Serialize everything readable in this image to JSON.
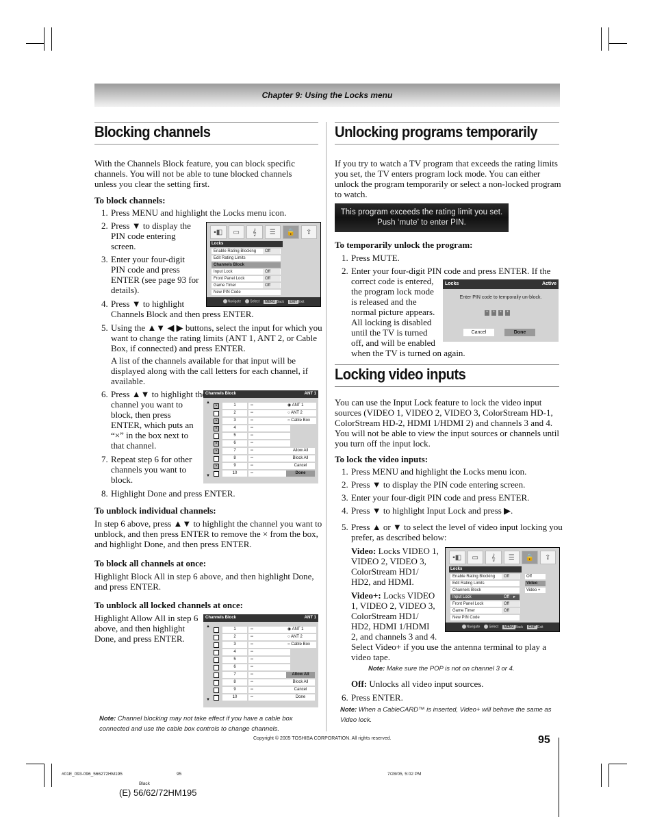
{
  "chapter": "Chapter 9: Using the Locks menu",
  "left": {
    "title": "Blocking channels",
    "intro": "With the Channels Block feature, you can block specific channels. You will not be able to tune blocked channels unless you clear the setting first.",
    "to_block_heading": "To block channels:",
    "steps": [
      {
        "n": "1.",
        "text": "Press MENU and highlight the Locks menu icon."
      },
      {
        "n": "2.",
        "lines": [
          "Press ▼ to display the",
          "PIN code entering",
          "screen."
        ]
      },
      {
        "n": "3.",
        "lines": [
          "Enter your four-digit",
          "PIN code and press",
          "ENTER (see page 93 for",
          "details)."
        ]
      },
      {
        "n": "4.",
        "lines": [
          "Press ▼ to highlight",
          "Channels Block and then press ENTER."
        ]
      },
      {
        "n": "5.",
        "lines": [
          "Using the ▲▼ ◀ ▶ buttons, select the input for which you",
          "want to change the rating limits (ANT 1, ANT 2, or Cable",
          "Box, if connected) and press ENTER."
        ]
      },
      {
        "n": "",
        "lines": [
          "A list of the channels available for that input will be",
          "displayed along with the call letters for each channel, if",
          "available."
        ]
      },
      {
        "n": "6.",
        "lines": [
          "Press ▲▼ to highlight the",
          "channel you want to",
          "block, then press",
          "ENTER, which puts an",
          "“×” in the box next to",
          "that channel."
        ]
      },
      {
        "n": "7.",
        "lines": [
          "Repeat step 6 for other",
          "channels you want to",
          "block."
        ]
      },
      {
        "n": "8.",
        "text": "Highlight Done and press ENTER."
      }
    ],
    "unblock_heading": "To unblock individual channels:",
    "unblock_lines": [
      "In step 6 above, press ▲▼ to highlight the channel you want to",
      "unblock, and then press ENTER to remove the × from the box,",
      "and highlight Done, and then press ENTER."
    ],
    "block_all_heading": "To block all channels at once:",
    "block_all_lines": [
      "Highlight Block All in step 6 above, and then highlight Done,",
      "and press ENTER."
    ],
    "unblock_all_heading": "To unblock all locked channels at once:",
    "unblock_all_lines": [
      "Highlight Allow All in step 6",
      "above, and then highlight",
      "Done, and press ENTER."
    ],
    "note_label": "Note:",
    "note_lines": [
      " Channel blocking may not take effect if you have a cable box",
      "connected and use the cable box controls to change channels."
    ]
  },
  "locks_menu": {
    "title": "Locks",
    "icons": [
      "picture-icon",
      "audio-icon",
      "music-icon",
      "setup-icon",
      "lock-icon",
      "applications-icon"
    ],
    "items": [
      {
        "label": "Enable Rating Blocking",
        "value": "Off"
      },
      {
        "label": "Edit Rating Limits",
        "value": ""
      },
      {
        "label": "Channels Block",
        "value": ""
      },
      {
        "label": "Input Lock",
        "value": "Off"
      },
      {
        "label": "Front Panel Lock",
        "value": "Off"
      },
      {
        "label": "Game Timer",
        "value": "Off"
      },
      {
        "label": "New PIN Code",
        "value": ""
      }
    ],
    "footer": {
      "navigate": "Navigate",
      "select": "Select",
      "back_key": "MENU",
      "back": "Back",
      "exit_key": "EXIT",
      "exit": "Exit"
    }
  },
  "channels_block_1": {
    "title": "Channels Block",
    "input": "ANT 1",
    "channels": [
      {
        "num": "1",
        "call": "--",
        "blocked": true
      },
      {
        "num": "2",
        "call": "--",
        "blocked": false
      },
      {
        "num": "3",
        "call": "--",
        "blocked": true
      },
      {
        "num": "4",
        "call": "--",
        "blocked": true
      },
      {
        "num": "5",
        "call": "--",
        "blocked": false
      },
      {
        "num": "6",
        "call": "--",
        "blocked": true
      },
      {
        "num": "7",
        "call": "--",
        "blocked": true
      },
      {
        "num": "8",
        "call": "--",
        "blocked": false
      },
      {
        "num": "9",
        "call": "--",
        "blocked": true
      },
      {
        "num": "10",
        "call": "--",
        "blocked": false
      }
    ],
    "inputs": [
      "ANT 1",
      "ANT 2",
      "Cable Box"
    ],
    "selected_input": "ANT 1",
    "actions": [
      "Allow All",
      "Block All",
      "Cancel",
      "Done"
    ],
    "highlighted_action": "Done"
  },
  "channels_block_2": {
    "title": "Channels Block",
    "input": "ANT 1",
    "channels": [
      {
        "num": "1",
        "call": "--",
        "blocked": false
      },
      {
        "num": "2",
        "call": "--",
        "blocked": false
      },
      {
        "num": "3",
        "call": "--",
        "blocked": false
      },
      {
        "num": "4",
        "call": "--",
        "blocked": false
      },
      {
        "num": "5",
        "call": "--",
        "blocked": false
      },
      {
        "num": "6",
        "call": "--",
        "blocked": false
      },
      {
        "num": "7",
        "call": "--",
        "blocked": false
      },
      {
        "num": "8",
        "call": "--",
        "blocked": false
      },
      {
        "num": "9",
        "call": "--",
        "blocked": false
      },
      {
        "num": "10",
        "call": "--",
        "blocked": false
      }
    ],
    "inputs": [
      "ANT 1",
      "ANT 2",
      "Cable Box"
    ],
    "selected_input": "ANT 1",
    "actions": [
      "Allow All",
      "Block All",
      "Cancel",
      "Done"
    ],
    "highlighted_action": "Allow All"
  },
  "right": {
    "title": "Unlocking programs temporarily",
    "intro_lines": [
      "If you try to watch a TV program that exceeds the rating limits",
      "you set, the TV enters program lock mode. You can either",
      "unlock the program temporarily or select a non-locked program",
      "to watch."
    ],
    "banner_lines": [
      "This program exceeds the rating limit you set.",
      "Push ‘mute’ to enter PIN."
    ],
    "temp_heading": "To temporarily unlock the program:",
    "temp_steps": [
      {
        "n": "1.",
        "lines": [
          "Press MUTE."
        ]
      },
      {
        "n": "2.",
        "lines": [
          "Enter your four-digit PIN code and press ENTER. If the",
          "correct code is entered,",
          "the program lock mode",
          "is released and the",
          "normal picture appears.",
          "All locking is disabled",
          "until the TV is turned",
          "off, and will be enabled",
          "when the TV is turned on again."
        ]
      }
    ],
    "pin_dialog": {
      "title": "Locks",
      "status": "Active",
      "message": "Enter PIN code to temporaily un-block.",
      "pin_mask": [
        "*",
        "*",
        "*",
        "*"
      ],
      "cancel": "Cancel",
      "done": "Done"
    },
    "title2": "Locking video inputs",
    "intro2_lines": [
      "You can use the Input Lock feature to lock the video input",
      "sources (VIDEO 1, VIDEO 2, VIDEO 3, ColorStream HD-1,",
      "ColorStream HD-2, HDMI 1/HDMI 2) and channels 3 and 4.",
      "You will not be able to view the input sources or channels until",
      "you turn off the input lock."
    ],
    "lock_heading": "To lock the video inputs:",
    "lock_steps": [
      {
        "n": "1.",
        "lines": [
          "Press MENU and highlight the Locks menu icon."
        ]
      },
      {
        "n": "2.",
        "lines": [
          "Press ▼ to display the PIN code entering screen."
        ]
      },
      {
        "n": "3.",
        "lines": [
          "Enter your four-digit PIN code and press ENTER."
        ]
      },
      {
        "n": "4.",
        "lines": [
          "Press ▼ to highlight Input Lock and press ▶."
        ]
      },
      {
        "n": "5.",
        "lines": [
          "Press ▲ or ▼ to select the level of video input locking you",
          "prefer, as described below:"
        ]
      }
    ],
    "video_label": "Video:",
    "video_lines": [
      " Locks VIDEO 1,",
      "VIDEO 2, VIDEO 3,",
      "ColorStream HD1/",
      "HD2, and HDMI."
    ],
    "videoplus_label": "Video+:",
    "videoplus_lines": [
      " Locks VIDEO",
      "1, VIDEO 2, VIDEO 3,",
      "ColorStream HD1/",
      "HD2, HDMI 1/HDMI",
      "2, and channels 3 and 4.",
      "Select Video+ if you use the antenna terminal to play a",
      "video tape."
    ],
    "pop_note_label": "Note:",
    "pop_note": " Make sure the POP is not on channel 3 or 4.",
    "off_label": "Off:",
    "off_text": " Unlocks all video input sources.",
    "step6": {
      "n": "6.",
      "text": "Press ENTER."
    },
    "cablecard_note_label": "Note:",
    "cablecard_note_lines": [
      " When a CableCARD™ is inserted, Video+ will behave the same as",
      "Video lock."
    ],
    "input_lock_options": [
      "Off",
      "Video",
      "Video +"
    ],
    "input_lock_selected": "Video"
  },
  "footer": {
    "copyright": "Copyright © 2005 TOSHIBA CORPORATION. All rights reserved.",
    "page_number": "95",
    "slug_file": "#01E_093-096_566272HM195",
    "slug_page": "95",
    "slug_date": "7/28/05, 5:02 PM",
    "slug_color": "Black",
    "model": "(E) 56/62/72HM195"
  }
}
